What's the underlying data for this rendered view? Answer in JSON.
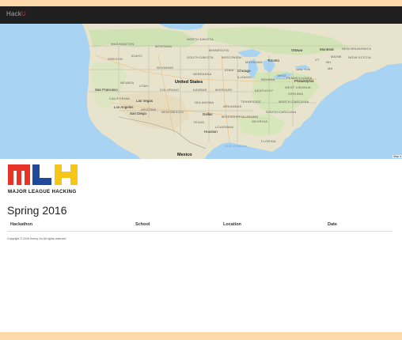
{
  "navbar": {
    "brand_prefix": "Hack",
    "brand_accent": "U"
  },
  "map": {
    "big_labels": [
      "United States",
      "Mexico"
    ],
    "cities": [
      "San Francisco",
      "Las Vegas",
      "Los Angeles",
      "San Diego",
      "Dallas",
      "Houston",
      "Chicago",
      "Toronto",
      "Ottawa",
      "Montreal",
      "Philadelphia",
      "New York"
    ],
    "regions": [
      "WASHINGTON",
      "MONTANA",
      "NORTH DAKOTA",
      "MINNESOTA",
      "OREGON",
      "IDAHO",
      "SOUTH DAKOTA",
      "WISCONSIN",
      "WYOMING",
      "MICHIGAN",
      "NEBRASKA",
      "IOWA",
      "NEVADA",
      "UTAH",
      "COLORADO",
      "KANSAS",
      "ILLINOIS",
      "INDIANA",
      "OHIO",
      "PENNSYLVANIA",
      "MISSOURI",
      "KENTUCKY",
      "WEST VIRGINIA",
      "VIRGINIA",
      "CALIFORNIA",
      "ARIZONA",
      "NEW MEXICO",
      "OKLAHOMA",
      "ARKANSAS",
      "TENNESSEE",
      "NORTH CAROLINA",
      "SOUTH CAROLINA",
      "MISSISSIPPI",
      "ALABAMA",
      "GEORGIA",
      "TEXAS",
      "LOUISIANA",
      "FLORIDA",
      "NEW BRUNSWICK",
      "MAINE",
      "NOVA SCOTIA",
      "VT",
      "NH",
      "MA"
    ],
    "water": "Gulf of Mexico",
    "attribution": "Map d"
  },
  "logo": {
    "letters": "MLH",
    "tagline": "MAJOR LEAGUE HACKING",
    "colors": [
      "#e73427",
      "#1f4a9c",
      "#f7c619"
    ]
  },
  "page": {
    "title": "Spring 2016"
  },
  "table": {
    "columns": [
      "Hackathon",
      "School",
      "Location",
      "Date"
    ],
    "rows": []
  },
  "footer": {
    "copyright": "Copyright © 2016 Kenny Ho All rights reserved"
  }
}
